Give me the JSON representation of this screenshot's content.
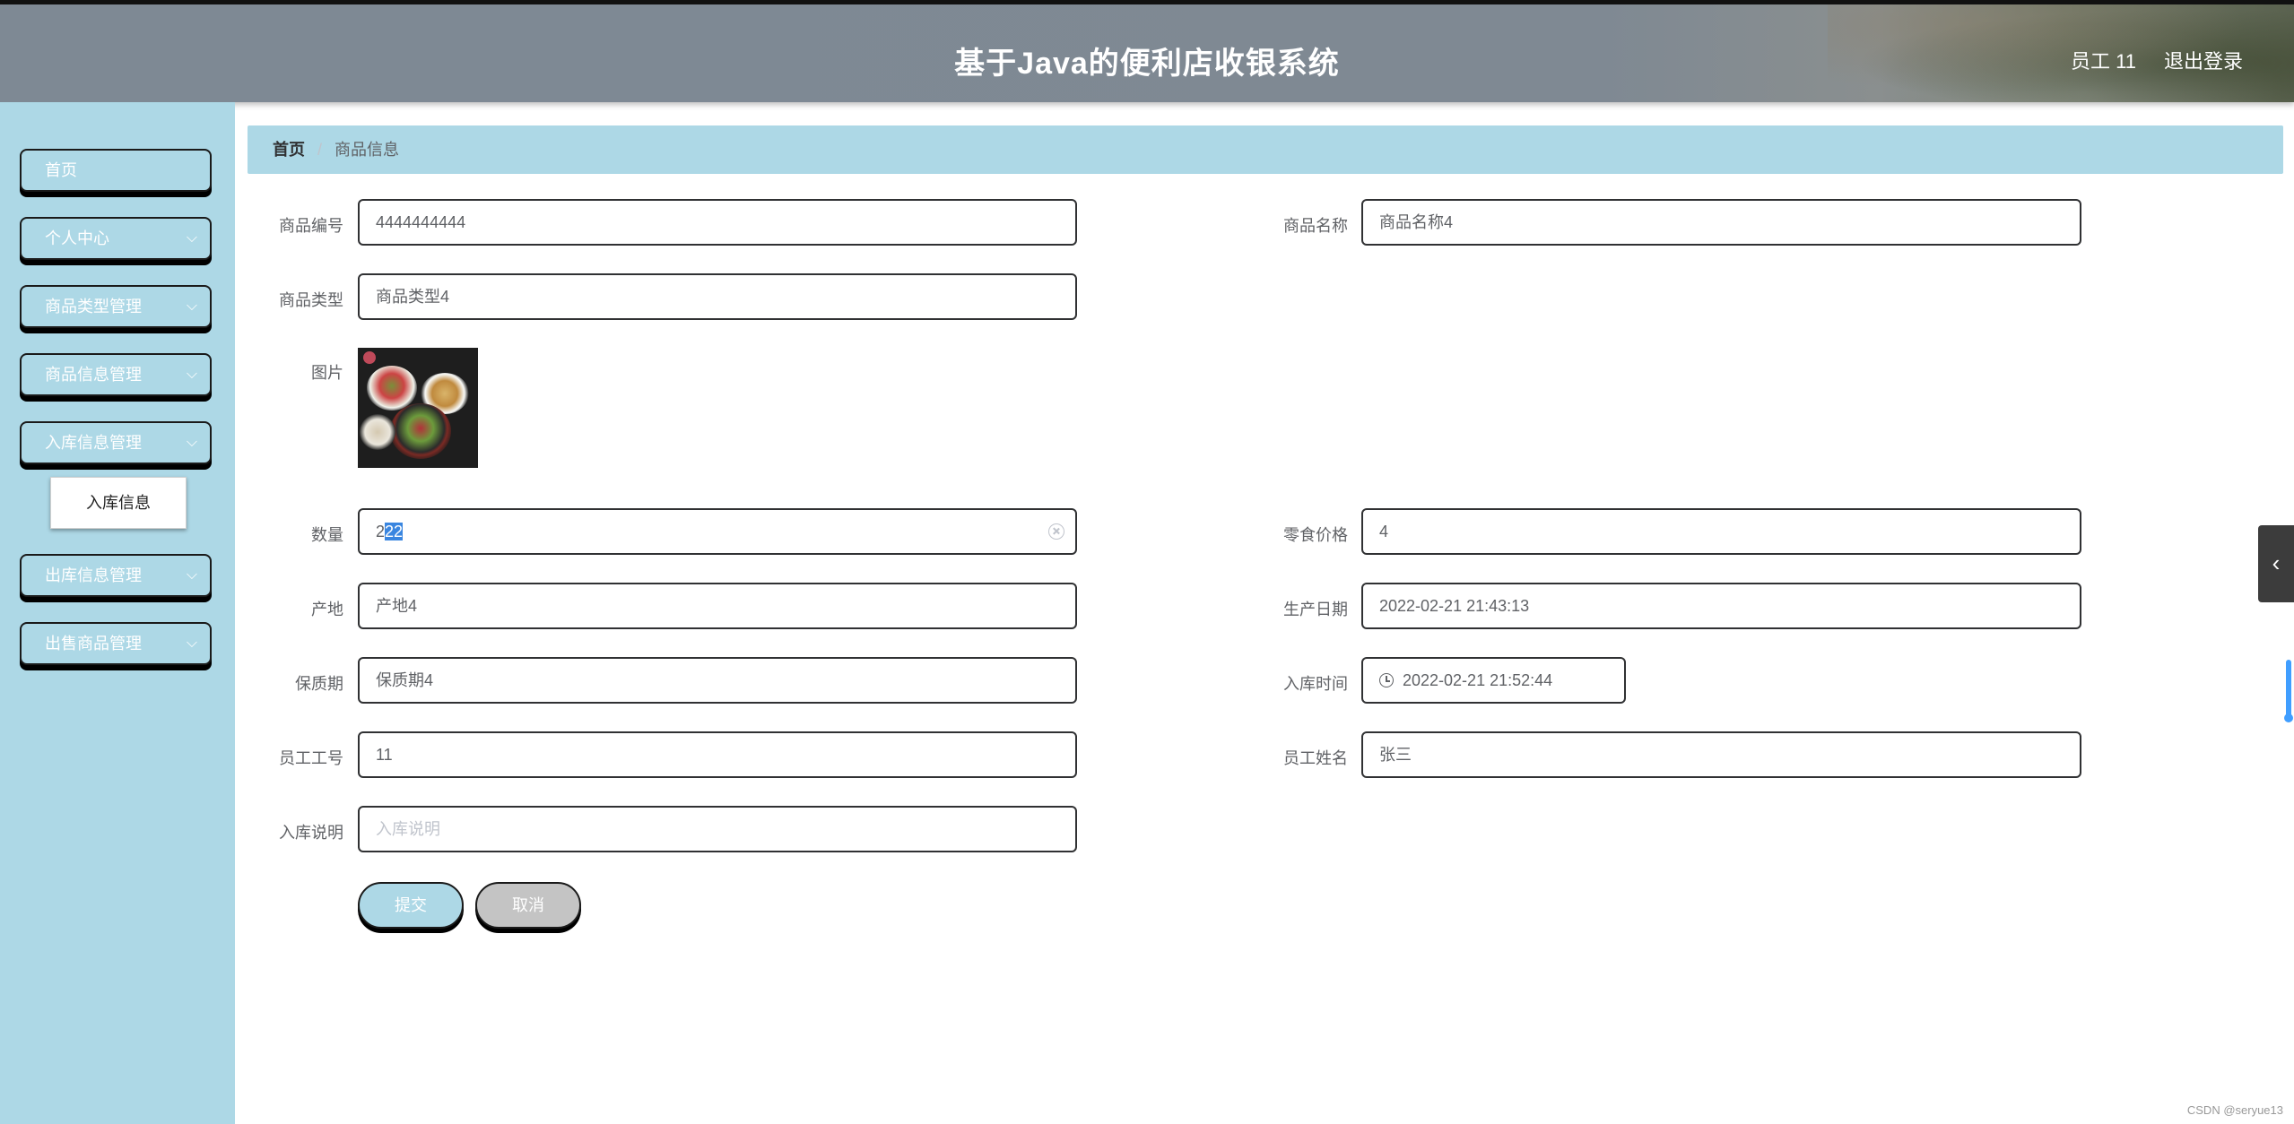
{
  "header": {
    "title": "基于Java的便利店收银系统",
    "user": "员工 11",
    "logout": "退出登录"
  },
  "sidebar": {
    "items": [
      {
        "label": "首页",
        "has_chevron": false
      },
      {
        "label": "个人中心",
        "has_chevron": true
      },
      {
        "label": "商品类型管理",
        "has_chevron": true
      },
      {
        "label": "商品信息管理",
        "has_chevron": true
      },
      {
        "label": "入库信息管理",
        "has_chevron": true
      },
      {
        "label": "出库信息管理",
        "has_chevron": true
      },
      {
        "label": "出售商品管理",
        "has_chevron": true
      }
    ],
    "submenu": {
      "label": "入库信息"
    },
    "chevron_icon": "chevron-down-icon"
  },
  "breadcrumb": {
    "home": "首页",
    "separator": "/",
    "current": "商品信息"
  },
  "form": {
    "product_code": {
      "label": "商品编号",
      "value": "4444444444"
    },
    "product_name": {
      "label": "商品名称",
      "value": "商品名称4"
    },
    "product_type": {
      "label": "商品类型",
      "value": "商品类型4"
    },
    "image": {
      "label": "图片"
    },
    "quantity": {
      "label": "数量",
      "value_prefix": "2",
      "value_selected": "22"
    },
    "snack_price": {
      "label": "零食价格",
      "value": "4"
    },
    "origin": {
      "label": "产地",
      "value": "产地4"
    },
    "production_date": {
      "label": "生产日期",
      "value": "2022-02-21 21:43:13"
    },
    "shelf_life": {
      "label": "保质期",
      "value": "保质期4"
    },
    "stock_in_time": {
      "label": "入库时间",
      "value": "2022-02-21 21:52:44"
    },
    "employee_no": {
      "label": "员工工号",
      "value": "11"
    },
    "employee_name": {
      "label": "员工姓名",
      "value": "张三"
    },
    "stock_in_note": {
      "label": "入库说明",
      "placeholder": "入库说明"
    }
  },
  "buttons": {
    "submit": "提交",
    "cancel": "取消"
  },
  "watermark": "CSDN @seryue13",
  "colors": {
    "accent": "#add8e6",
    "header": "#7e8994",
    "cancel": "#c4c4c4"
  }
}
